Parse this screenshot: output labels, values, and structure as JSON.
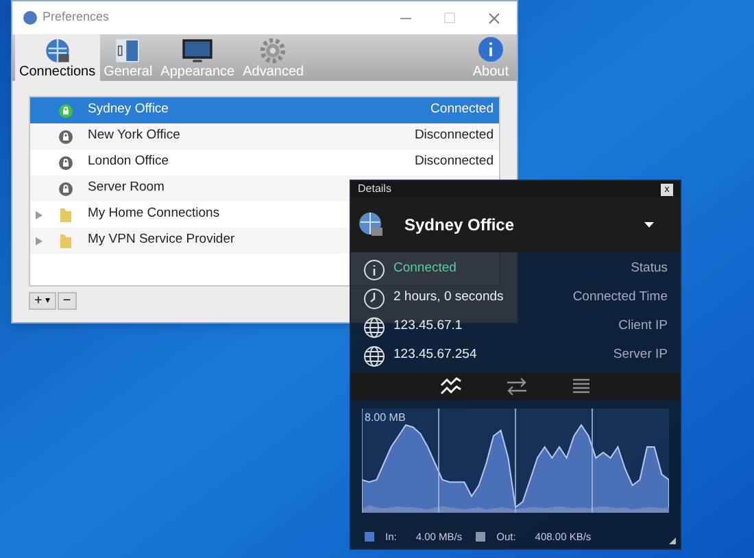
{
  "preferences_window": {
    "title": "Preferences",
    "toolbar": [
      {
        "label": "Connections",
        "selected": true
      },
      {
        "label": "General",
        "selected": false
      },
      {
        "label": "Appearance",
        "selected": false
      },
      {
        "label": "Advanced",
        "selected": false
      }
    ],
    "about_button": {
      "label": "About"
    },
    "connections": [
      {
        "kind": "connection",
        "name": "Sydney Office",
        "status": "Connected",
        "connected": true,
        "selected": true
      },
      {
        "kind": "connection",
        "name": "New York Office",
        "status": "Disconnected",
        "connected": false,
        "selected": false
      },
      {
        "kind": "connection",
        "name": "London Office",
        "status": "Disconnected",
        "connected": false,
        "selected": false
      },
      {
        "kind": "connection",
        "name": "Server Room",
        "connected": false,
        "selected": false
      },
      {
        "kind": "folder",
        "name": "My Home Connections",
        "expanded": false,
        "selected": false
      },
      {
        "kind": "folder",
        "name": "My VPN Service Provider",
        "expanded": false,
        "selected": false
      }
    ],
    "add_button": {
      "label": "+",
      "caret": "▾"
    },
    "remove_button": {
      "label": "−"
    }
  },
  "details_window": {
    "title": "Details",
    "close": "x",
    "connection_name": "Sydney Office",
    "info": [
      {
        "value": "Connected",
        "label": "Status",
        "highlight": true
      },
      {
        "value": "2 hours, 0 seconds",
        "label": "Connected Time",
        "highlight": false
      },
      {
        "value": "123.45.67.1",
        "label": "Client IP",
        "highlight": false
      },
      {
        "value": "123.45.67.254",
        "label": "Server IP",
        "highlight": false
      }
    ],
    "view_tabs": [
      {
        "selected": true
      },
      {
        "selected": false
      },
      {
        "selected": false
      }
    ],
    "graph": {
      "scale_label": "8.00 MB"
    },
    "legend": [
      {
        "label": "In:",
        "value": "4.00 MB/s",
        "color": "#4a78c8"
      },
      {
        "label": "Out:",
        "value": "408.00 KB/s",
        "color": "#8a96a8"
      }
    ]
  }
}
